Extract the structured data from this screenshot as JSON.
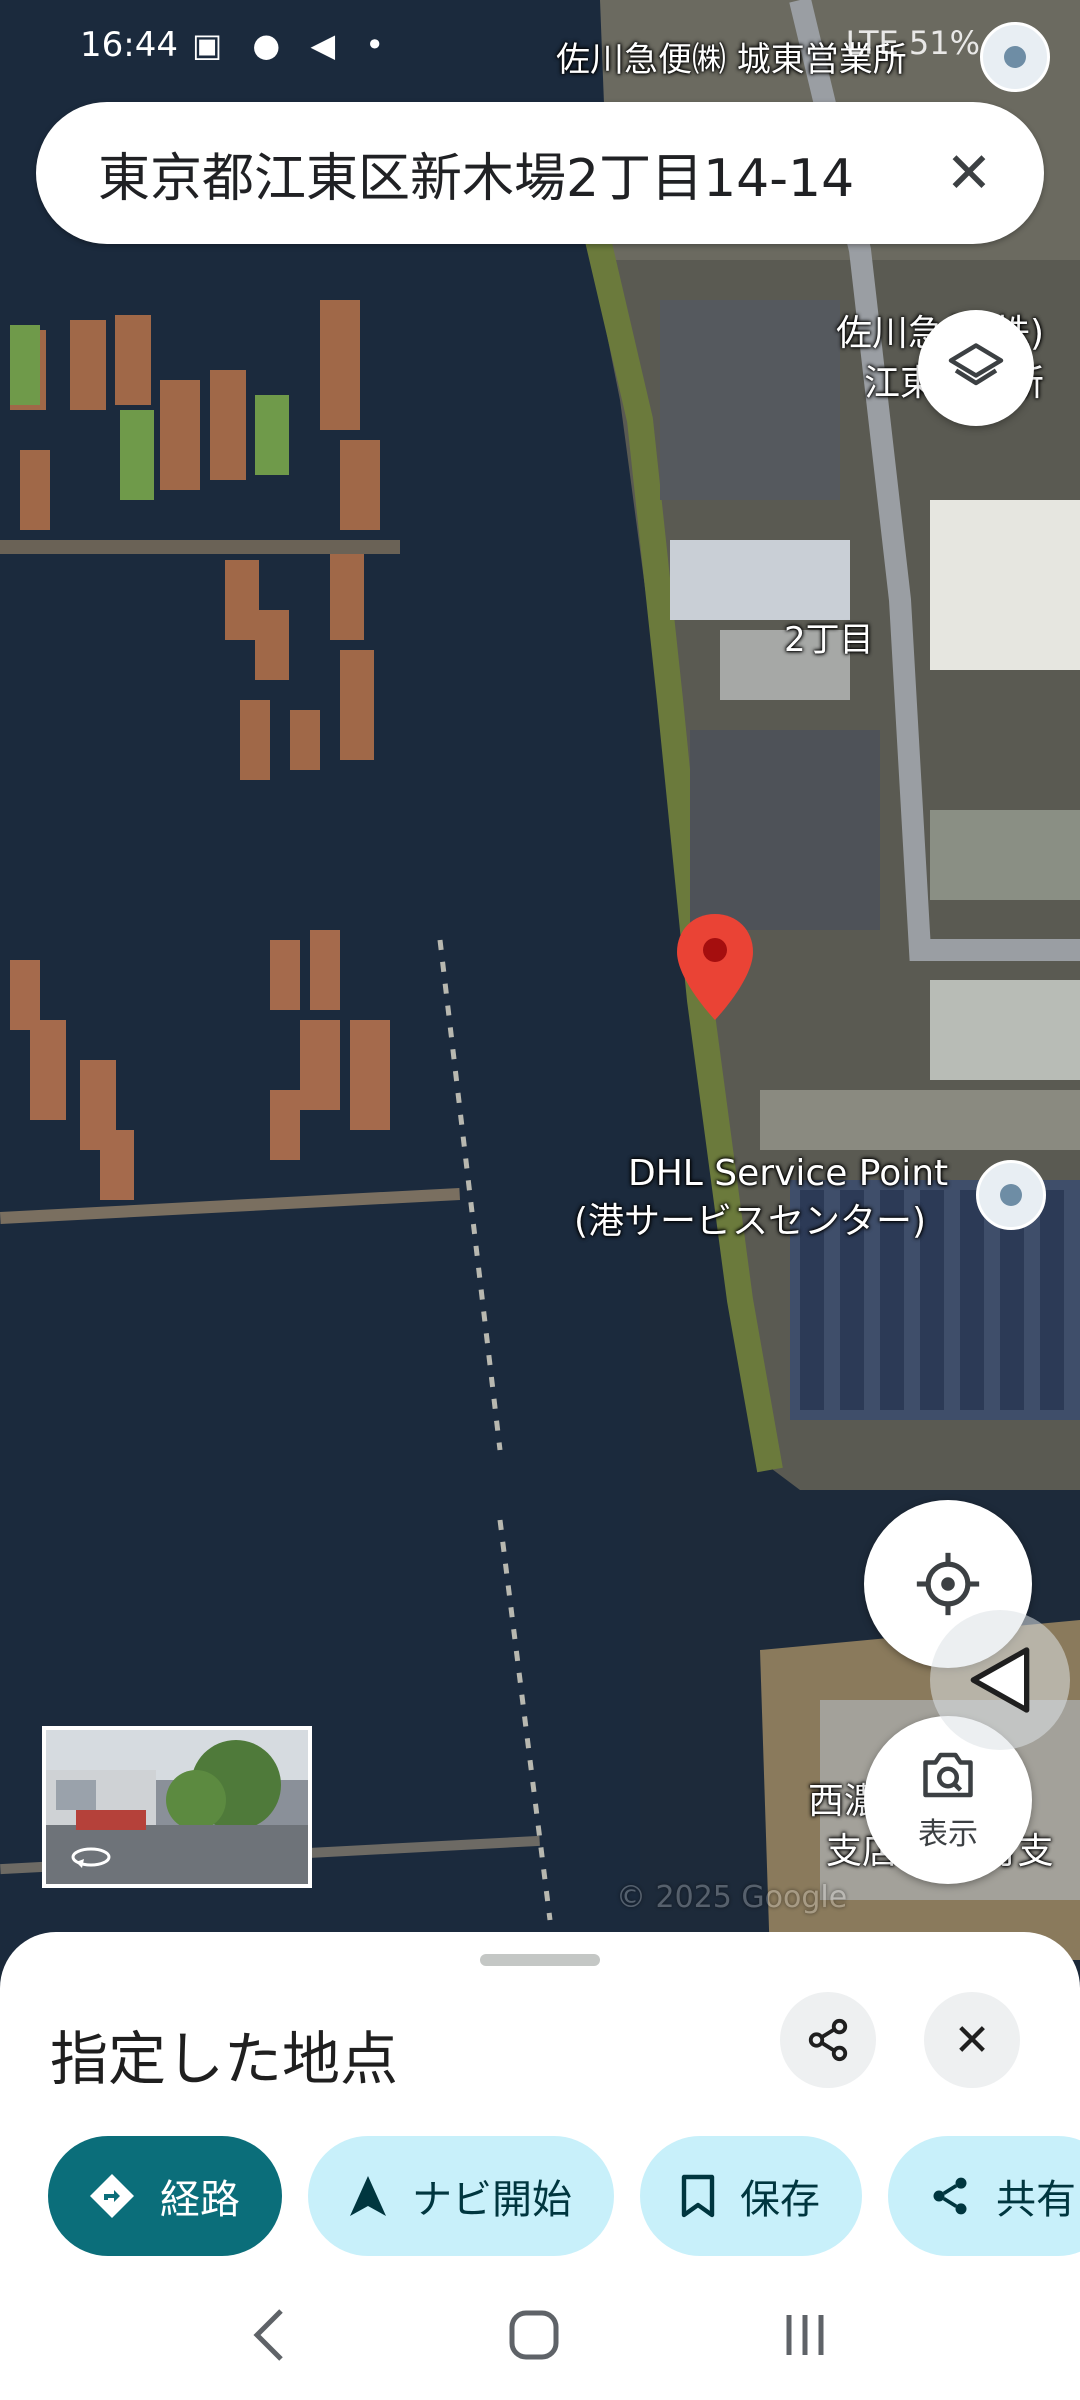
{
  "status_bar": {
    "time": "16:44",
    "notification_icons": [
      "image-icon",
      "chat-icon",
      "send-icon",
      "dot-icon"
    ],
    "right_text": "LTE 51%"
  },
  "search": {
    "query": "東京都江東区新木場2丁目14-14",
    "clear_icon": "close-icon"
  },
  "map": {
    "labels": {
      "sagawa_top": "佐川急便㈱ 城東営業所",
      "sagawa_side_1": "佐川急便(株)",
      "sagawa_side_2": "江東営業所",
      "district": "2丁目",
      "dhl_1": "DHL Service Point",
      "dhl_2": "(港サービスセンター)",
      "bottom_right_1": "西濃運輸 東",
      "bottom_right_2": "支店 新砂町支",
      "watermark": "© 2025 Google"
    },
    "pin_color": "#ea4335"
  },
  "buttons": {
    "layers_icon": "layers-icon",
    "locate_icon": "my-location-icon",
    "lens_label": "表示",
    "lens_icon": "camera-search-icon"
  },
  "street_view": {
    "icon": "rotate-360-icon"
  },
  "sheet": {
    "title": "指定した地点",
    "share_icon": "share-icon",
    "close_icon": "close-icon",
    "chips": [
      {
        "label": "経路",
        "icon": "directions-icon"
      },
      {
        "label": "ナビ開始",
        "icon": "navigation-icon"
      },
      {
        "label": "保存",
        "icon": "bookmark-icon"
      },
      {
        "label": "共有",
        "icon": "share-icon"
      }
    ]
  },
  "colors": {
    "primary_chip": "#0b6e7a",
    "secondary_chip": "#c8f0fa"
  },
  "system_nav": [
    "back-icon",
    "home-icon",
    "recents-icon"
  ]
}
